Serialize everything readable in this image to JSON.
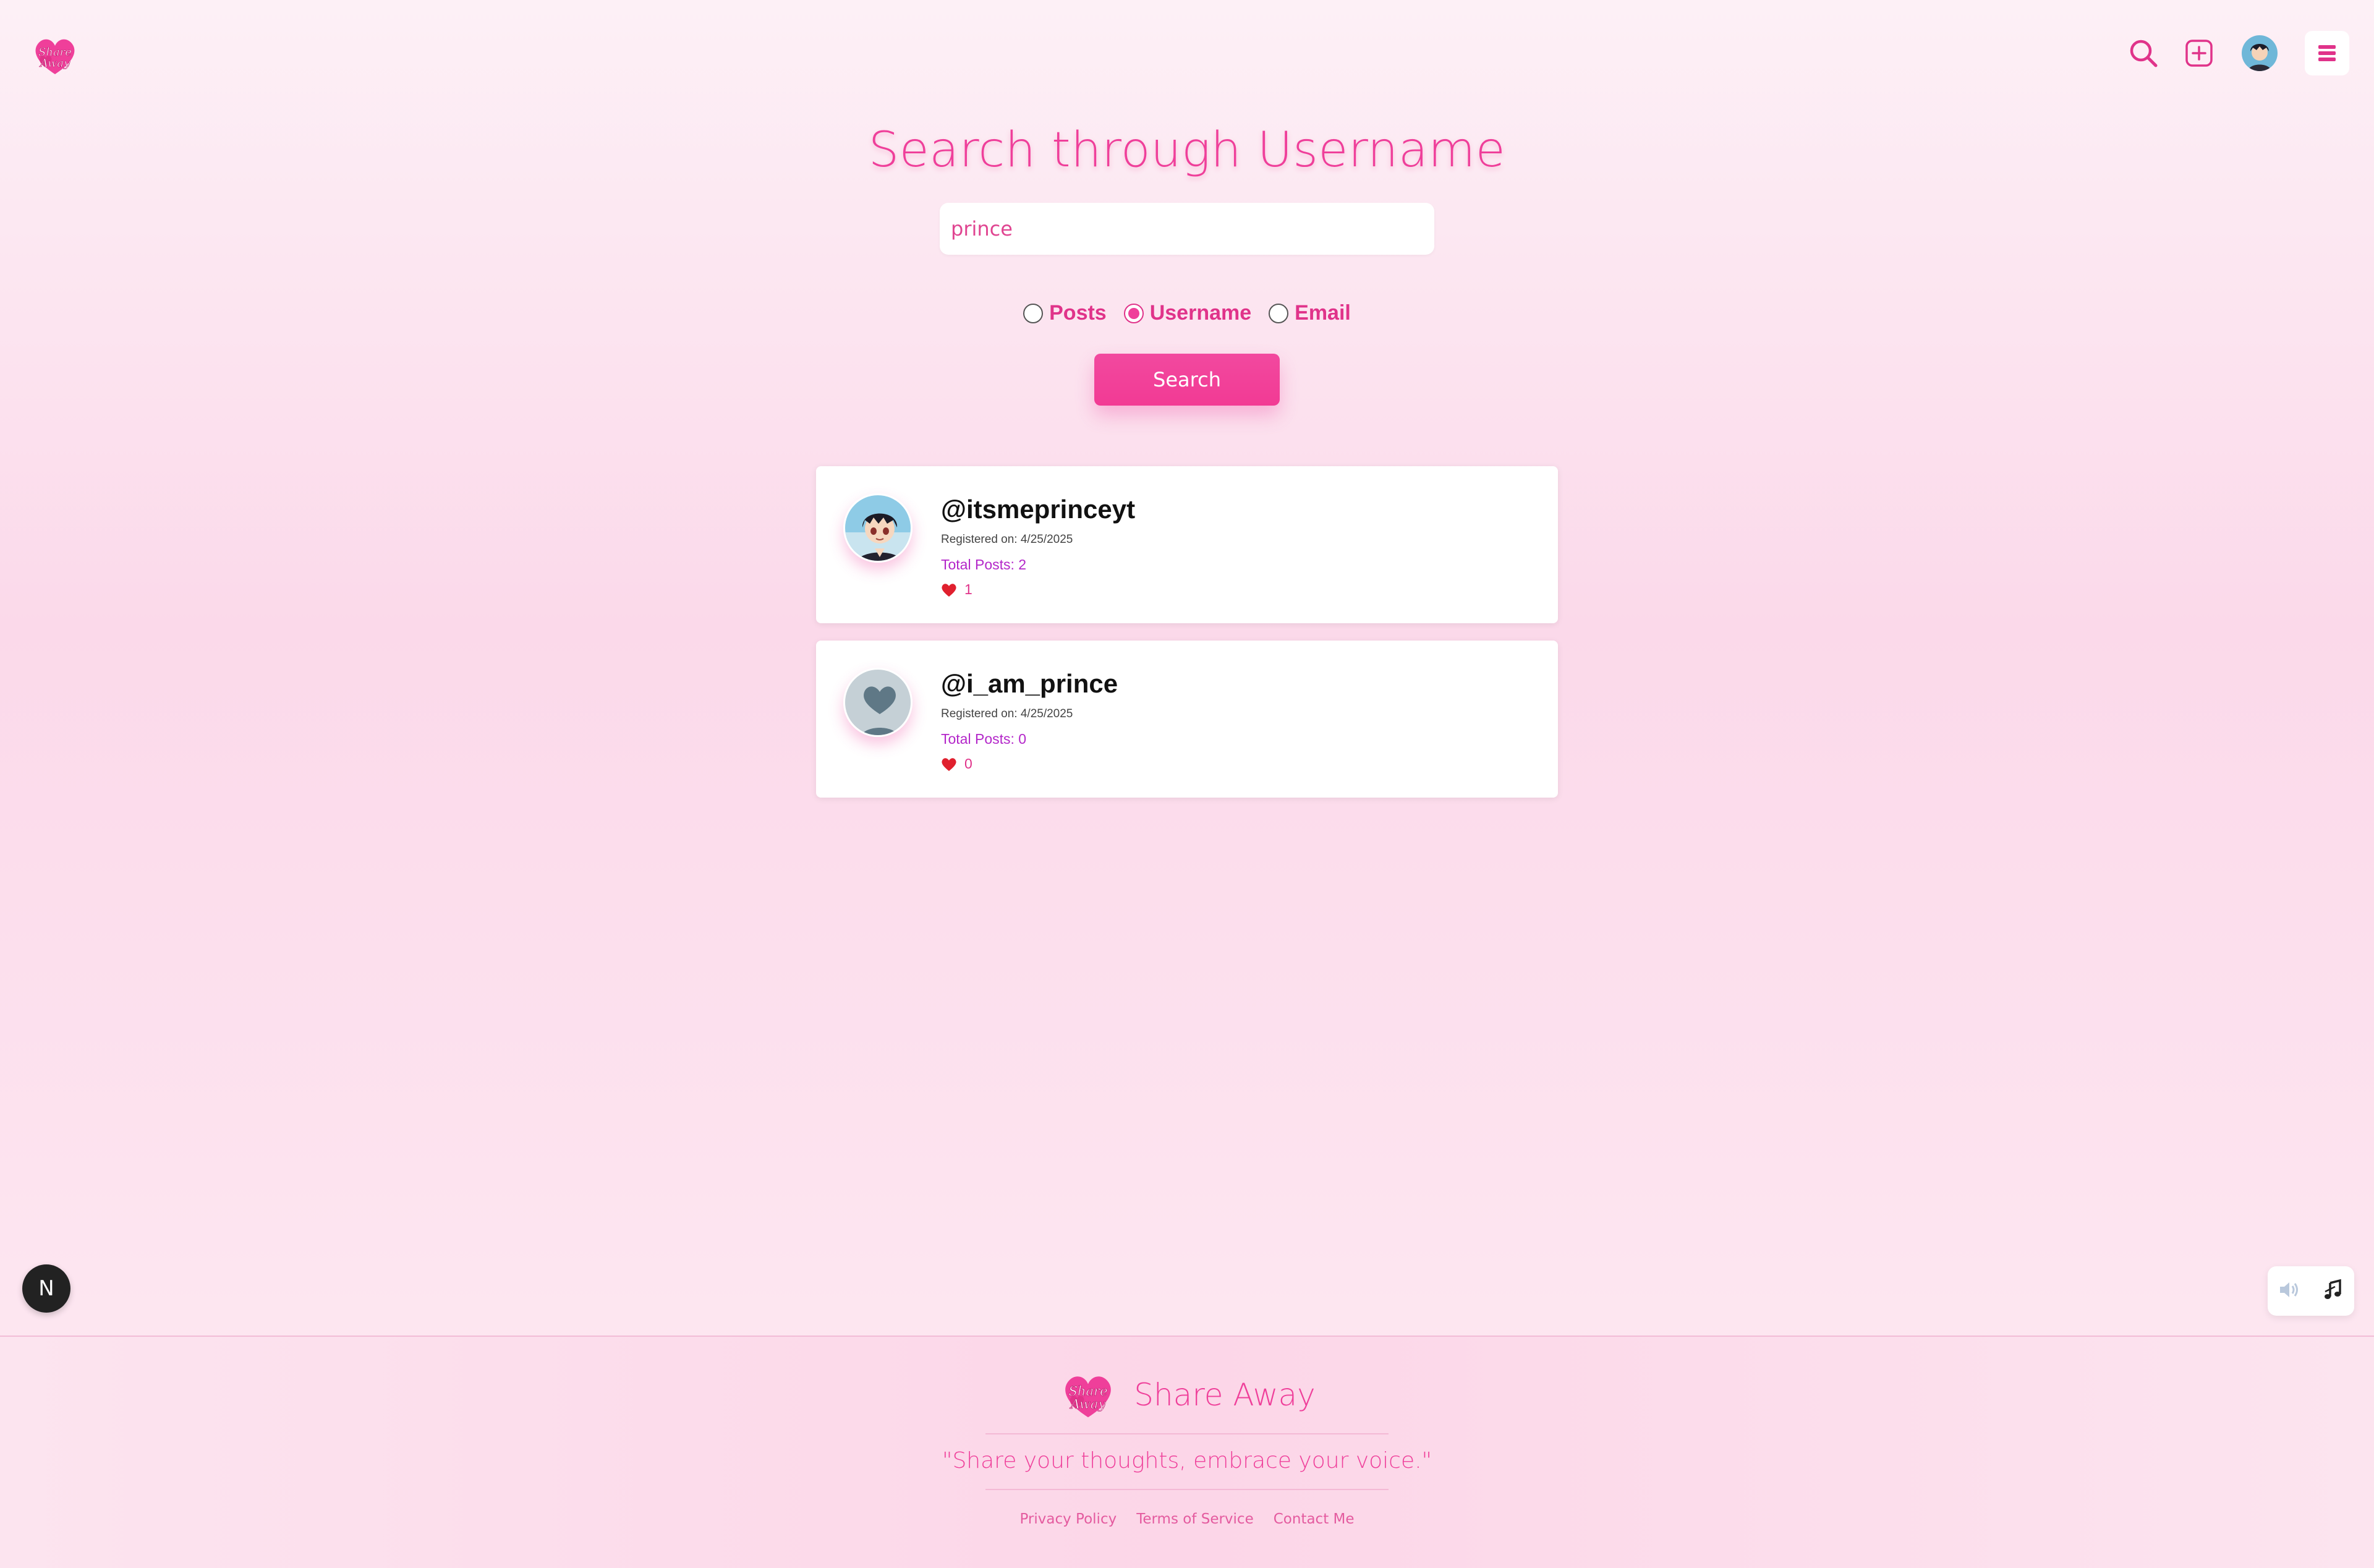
{
  "brand": {
    "name": "Share Away",
    "logo_text": "Share Away",
    "tagline": "\"Share your thoughts, embrace your voice.\""
  },
  "header": {
    "icons": [
      "search-icon",
      "add-post-icon",
      "user-avatar",
      "hamburger-menu-icon"
    ]
  },
  "search": {
    "title": "Search through Username",
    "query": "prince",
    "options": [
      {
        "label": "Posts",
        "checked": false
      },
      {
        "label": "Username",
        "checked": true
      },
      {
        "label": "Email",
        "checked": false
      }
    ],
    "button_label": "Search"
  },
  "results": [
    {
      "username": "@itsmeprinceyt",
      "registered": "Registered on: 4/25/2025",
      "total_posts": "Total Posts: 2",
      "likes": "1",
      "avatar": "anime-avatar"
    },
    {
      "username": "@i_am_prince",
      "registered": "Registered on: 4/25/2025",
      "total_posts": "Total Posts: 0",
      "likes": "0",
      "avatar": "default-avatar"
    }
  ],
  "floating": {
    "n_badge": "N",
    "music_icons": [
      "speaker-icon",
      "music-note-icon"
    ]
  },
  "footer": {
    "links": [
      "Privacy Policy",
      "Terms of Service",
      "Contact Me"
    ]
  },
  "colors": {
    "accent": "#ef3f9a",
    "purple": "#b326c9",
    "heart": "#e0202e"
  }
}
